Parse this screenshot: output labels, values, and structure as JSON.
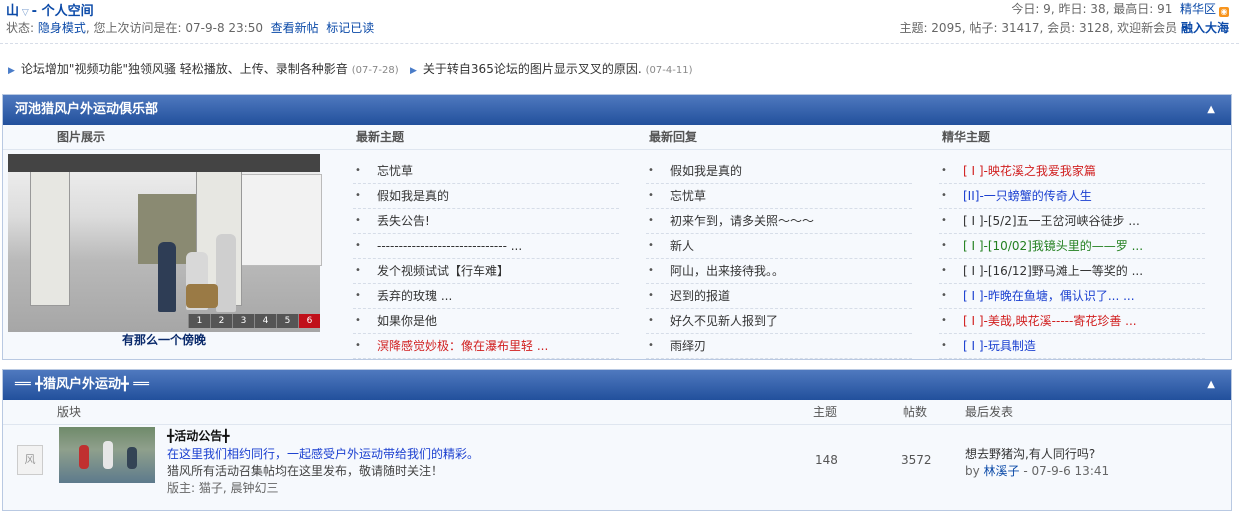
{
  "header": {
    "crumb": "山",
    "crumb_sep": "-",
    "crumb_current": "个人空间",
    "status_prefix": "状态:",
    "status_mode": "隐身模式",
    "status_last_visit": ", 您上次访问是在: 07-9-8 23:50",
    "link_new_posts": "查看新帖",
    "link_mark_read": "标记已读",
    "stats_today": "今日: 9, 昨日: 38, 最高日: 91",
    "link_digest": "精华区",
    "stats_totals": "主题: 2095, 帖子: 31417, 会员: 3128, 欢迎新会员",
    "newest_member": "融入大海"
  },
  "announcements": [
    {
      "text": "论坛增加\"视频功能\"独领风骚 轻松播放、上传、录制各种影音",
      "date": "(07-7-28)"
    },
    {
      "text": "关于转自365论坛的图片显示叉叉的原因.",
      "date": "(07-4-11)"
    }
  ],
  "club": {
    "title": "河池猎风户外运动俱乐部",
    "col_photo": "图片展示",
    "col_latest": "最新主题",
    "col_replies": "最新回复",
    "col_digest": "精华主题",
    "photo_caption": "有那么一个傍晚",
    "photo_pages": [
      "1",
      "2",
      "3",
      "4",
      "5",
      "6"
    ],
    "latest_topics": [
      {
        "text": "忘忧草",
        "color": ""
      },
      {
        "text": "假如我是真的",
        "color": ""
      },
      {
        "text": "丢失公告!",
        "color": ""
      },
      {
        "text": "------------------------------ ...",
        "color": ""
      },
      {
        "text": "发个视频试试【行车难】",
        "color": ""
      },
      {
        "text": "丢弃的玫瑰 ...",
        "color": ""
      },
      {
        "text": "如果你是他",
        "color": ""
      },
      {
        "text": "溟降感觉妙极：像在瀑布里轻 ...",
        "color": "red"
      }
    ],
    "latest_replies": [
      {
        "text": "假如我是真的",
        "color": ""
      },
      {
        "text": "忘忧草",
        "color": ""
      },
      {
        "text": "初来乍到，请多关照～～～",
        "color": ""
      },
      {
        "text": "新人",
        "color": ""
      },
      {
        "text": "阿山，出来接待我。。",
        "color": ""
      },
      {
        "text": "迟到的报道",
        "color": ""
      },
      {
        "text": "好久不见新人报到了",
        "color": ""
      },
      {
        "text": "雨绎刃",
        "color": ""
      }
    ],
    "digest_topics": [
      {
        "text": "[ I ]-映花溪之我爱我家篇",
        "color": "red"
      },
      {
        "text": "[II]-一只螃蟹的传奇人生",
        "color": "blue"
      },
      {
        "text": "[ I ]-[5/2]五一王岔河峡谷徒步 ...",
        "color": ""
      },
      {
        "text": "[ I ]-[10/02]我镜头里的——罗 ...",
        "color": "green"
      },
      {
        "text": "[ I ]-[16/12]野马滩上一等奖的 ...",
        "color": ""
      },
      {
        "text": "[ I ]-昨晚在鱼塘，偶认识了... ...",
        "color": "blue"
      },
      {
        "text": "[ I ]-美哉,映花溪-----寄花珍善 ...",
        "color": "red"
      },
      {
        "text": "[ I ]-玩具制造",
        "color": "blue"
      }
    ]
  },
  "forum_section": {
    "title": "══ ╋猎风户外运动╋ ══",
    "col_board": "版块",
    "col_topics": "主题",
    "col_posts": "帖数",
    "col_last": "最后发表",
    "rows": [
      {
        "name": "╋活动公告╋",
        "desc_blue": "在这里我们相约同行，一起感受户外运动带给我们的精彩。",
        "desc": "猎风所有活动召集帖均在这里发布，敬请随时关注！",
        "mods": "版主: 猫子, 晨钟幻三",
        "topics": "148",
        "posts": "3572",
        "last_title": "想去野猪沟,有人同行吗?",
        "last_by_prefix": "by",
        "last_by": "林溪子",
        "last_time": "- 07-9-6 13:41",
        "icon_char": "风"
      }
    ]
  }
}
